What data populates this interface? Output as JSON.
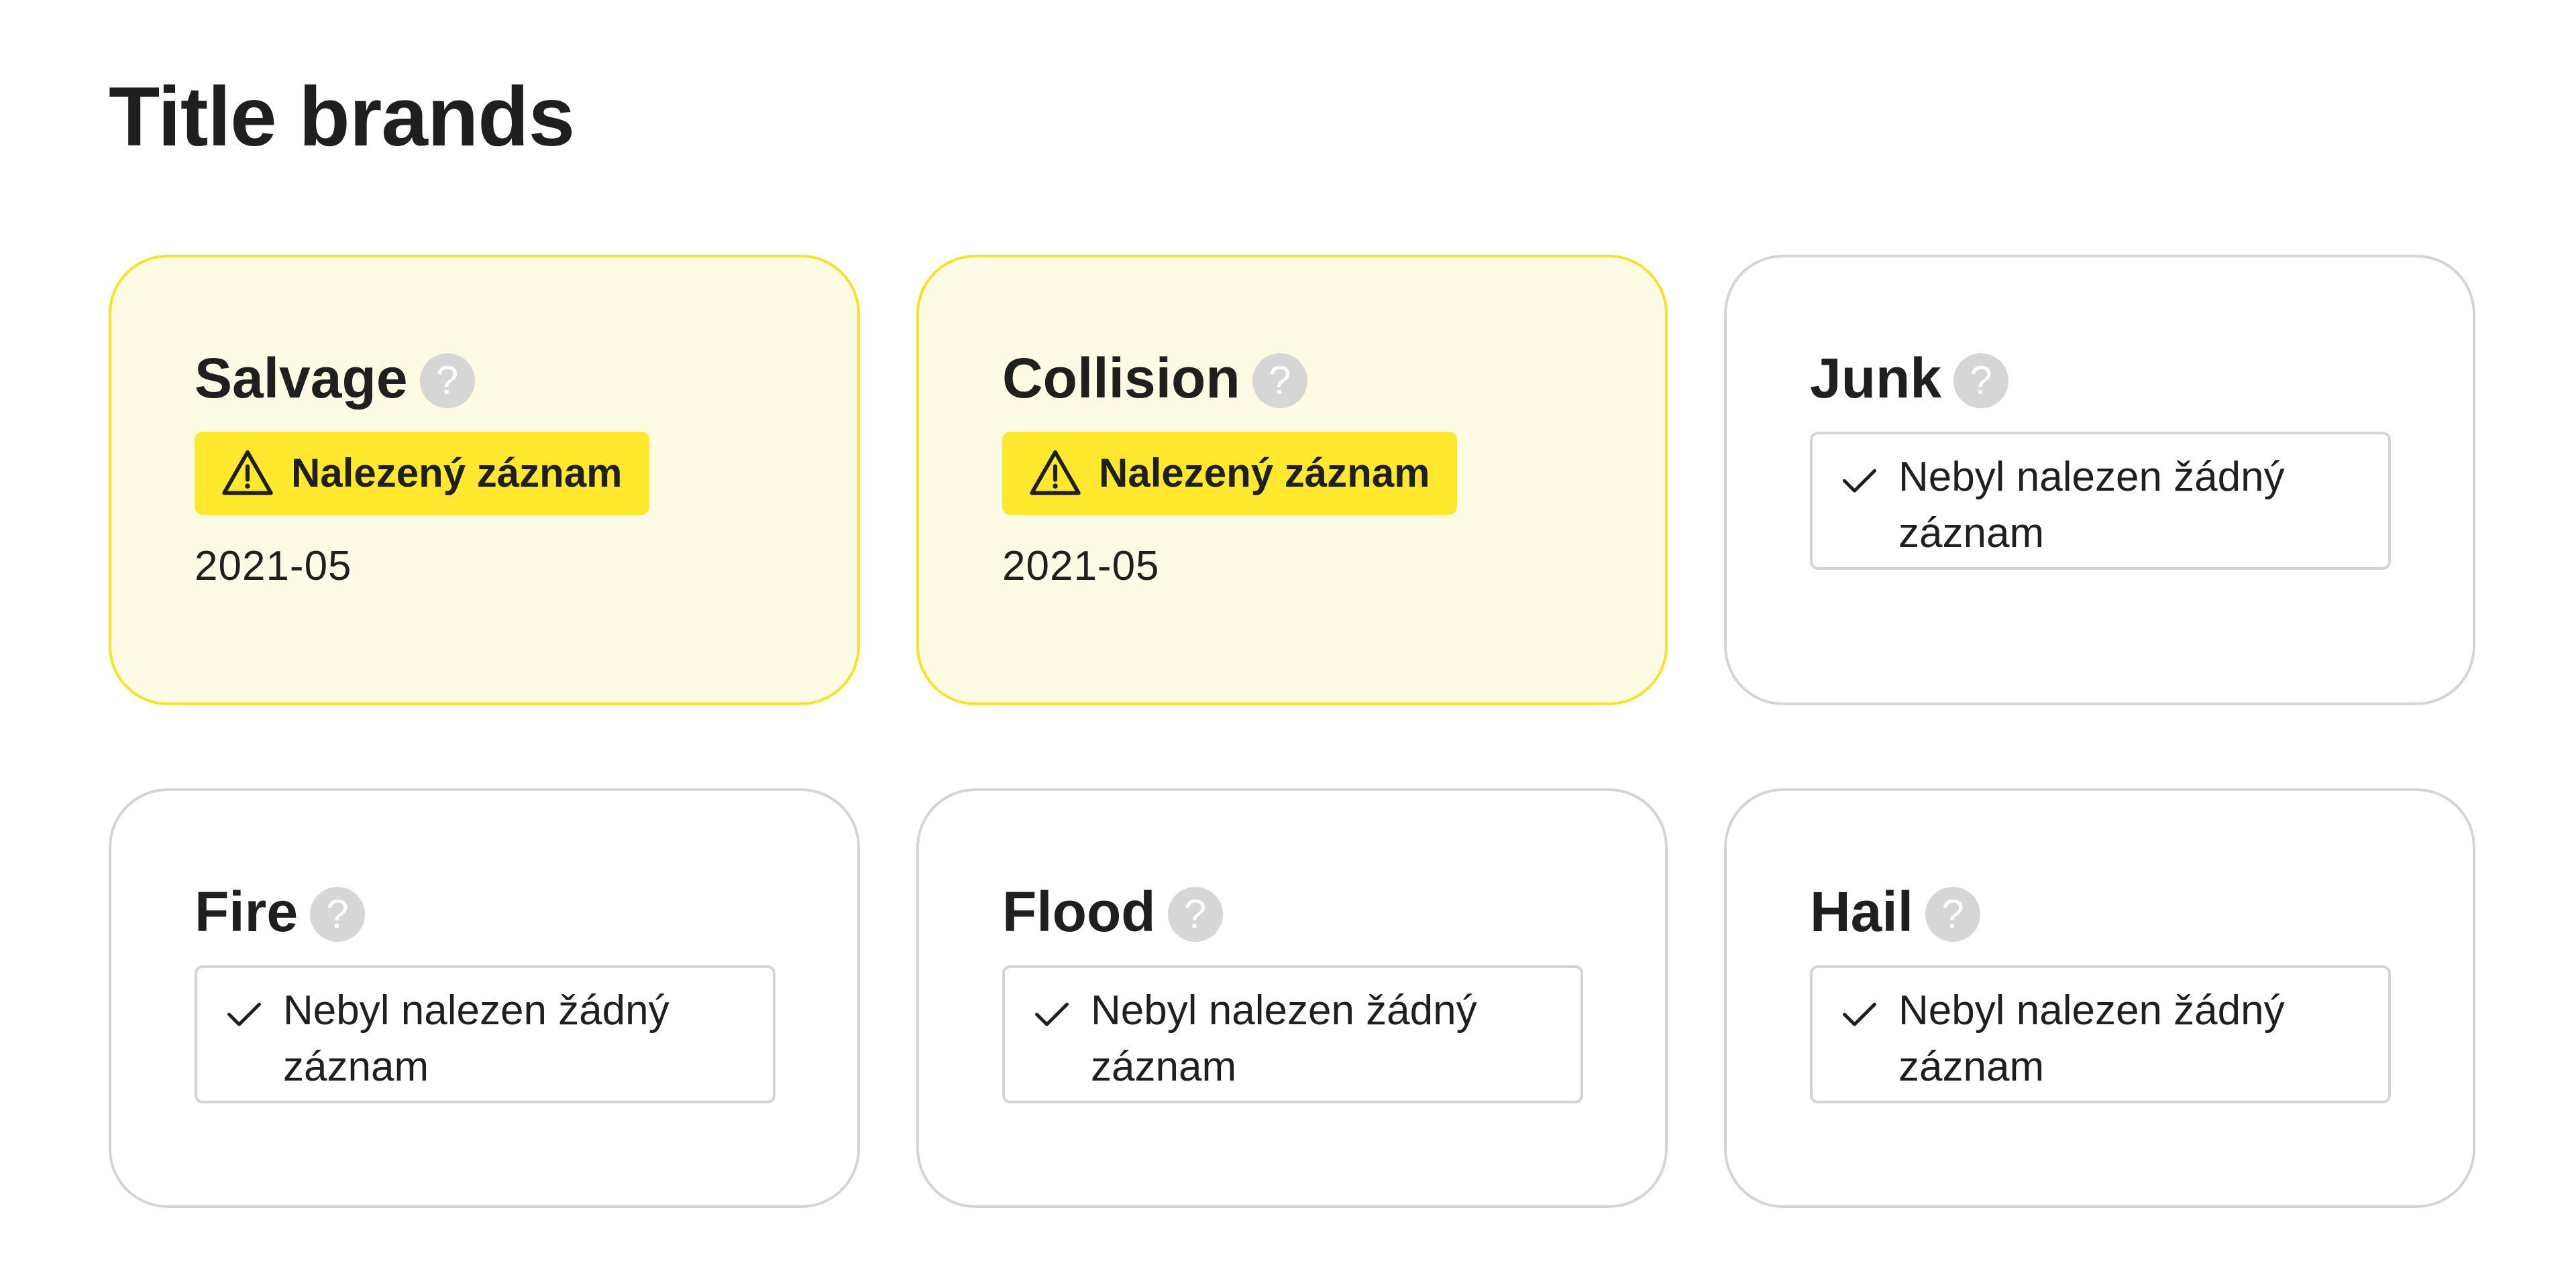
{
  "page": {
    "title": "Title brands"
  },
  "colors": {
    "found_background": "#fefbe4",
    "found_border": "#f5e32a",
    "badge_background": "#ffe82e",
    "neutral_border": "#d4d4d4",
    "help_icon": "#d6d6d6"
  },
  "cards": [
    {
      "title": "Salvage",
      "status": "found",
      "badge": "Nalezený záznam",
      "date": "2021-05",
      "icon": "help-icon"
    },
    {
      "title": "Collision",
      "status": "found",
      "badge": "Nalezený záznam",
      "date": "2021-05",
      "icon": "help-icon"
    },
    {
      "title": "Junk",
      "status": "not-found",
      "message": "Nebyl nalezen žádný záznam",
      "icon": "help-icon"
    },
    {
      "title": "Fire",
      "status": "not-found",
      "message": "Nebyl nalezen žádný záznam",
      "icon": "help-icon"
    },
    {
      "title": "Flood",
      "status": "not-found",
      "message": "Nebyl nalezen žádný záznam",
      "icon": "help-icon"
    },
    {
      "title": "Hail",
      "status": "not-found",
      "message": "Nebyl nalezen žádný záznam",
      "icon": "help-icon"
    }
  ]
}
